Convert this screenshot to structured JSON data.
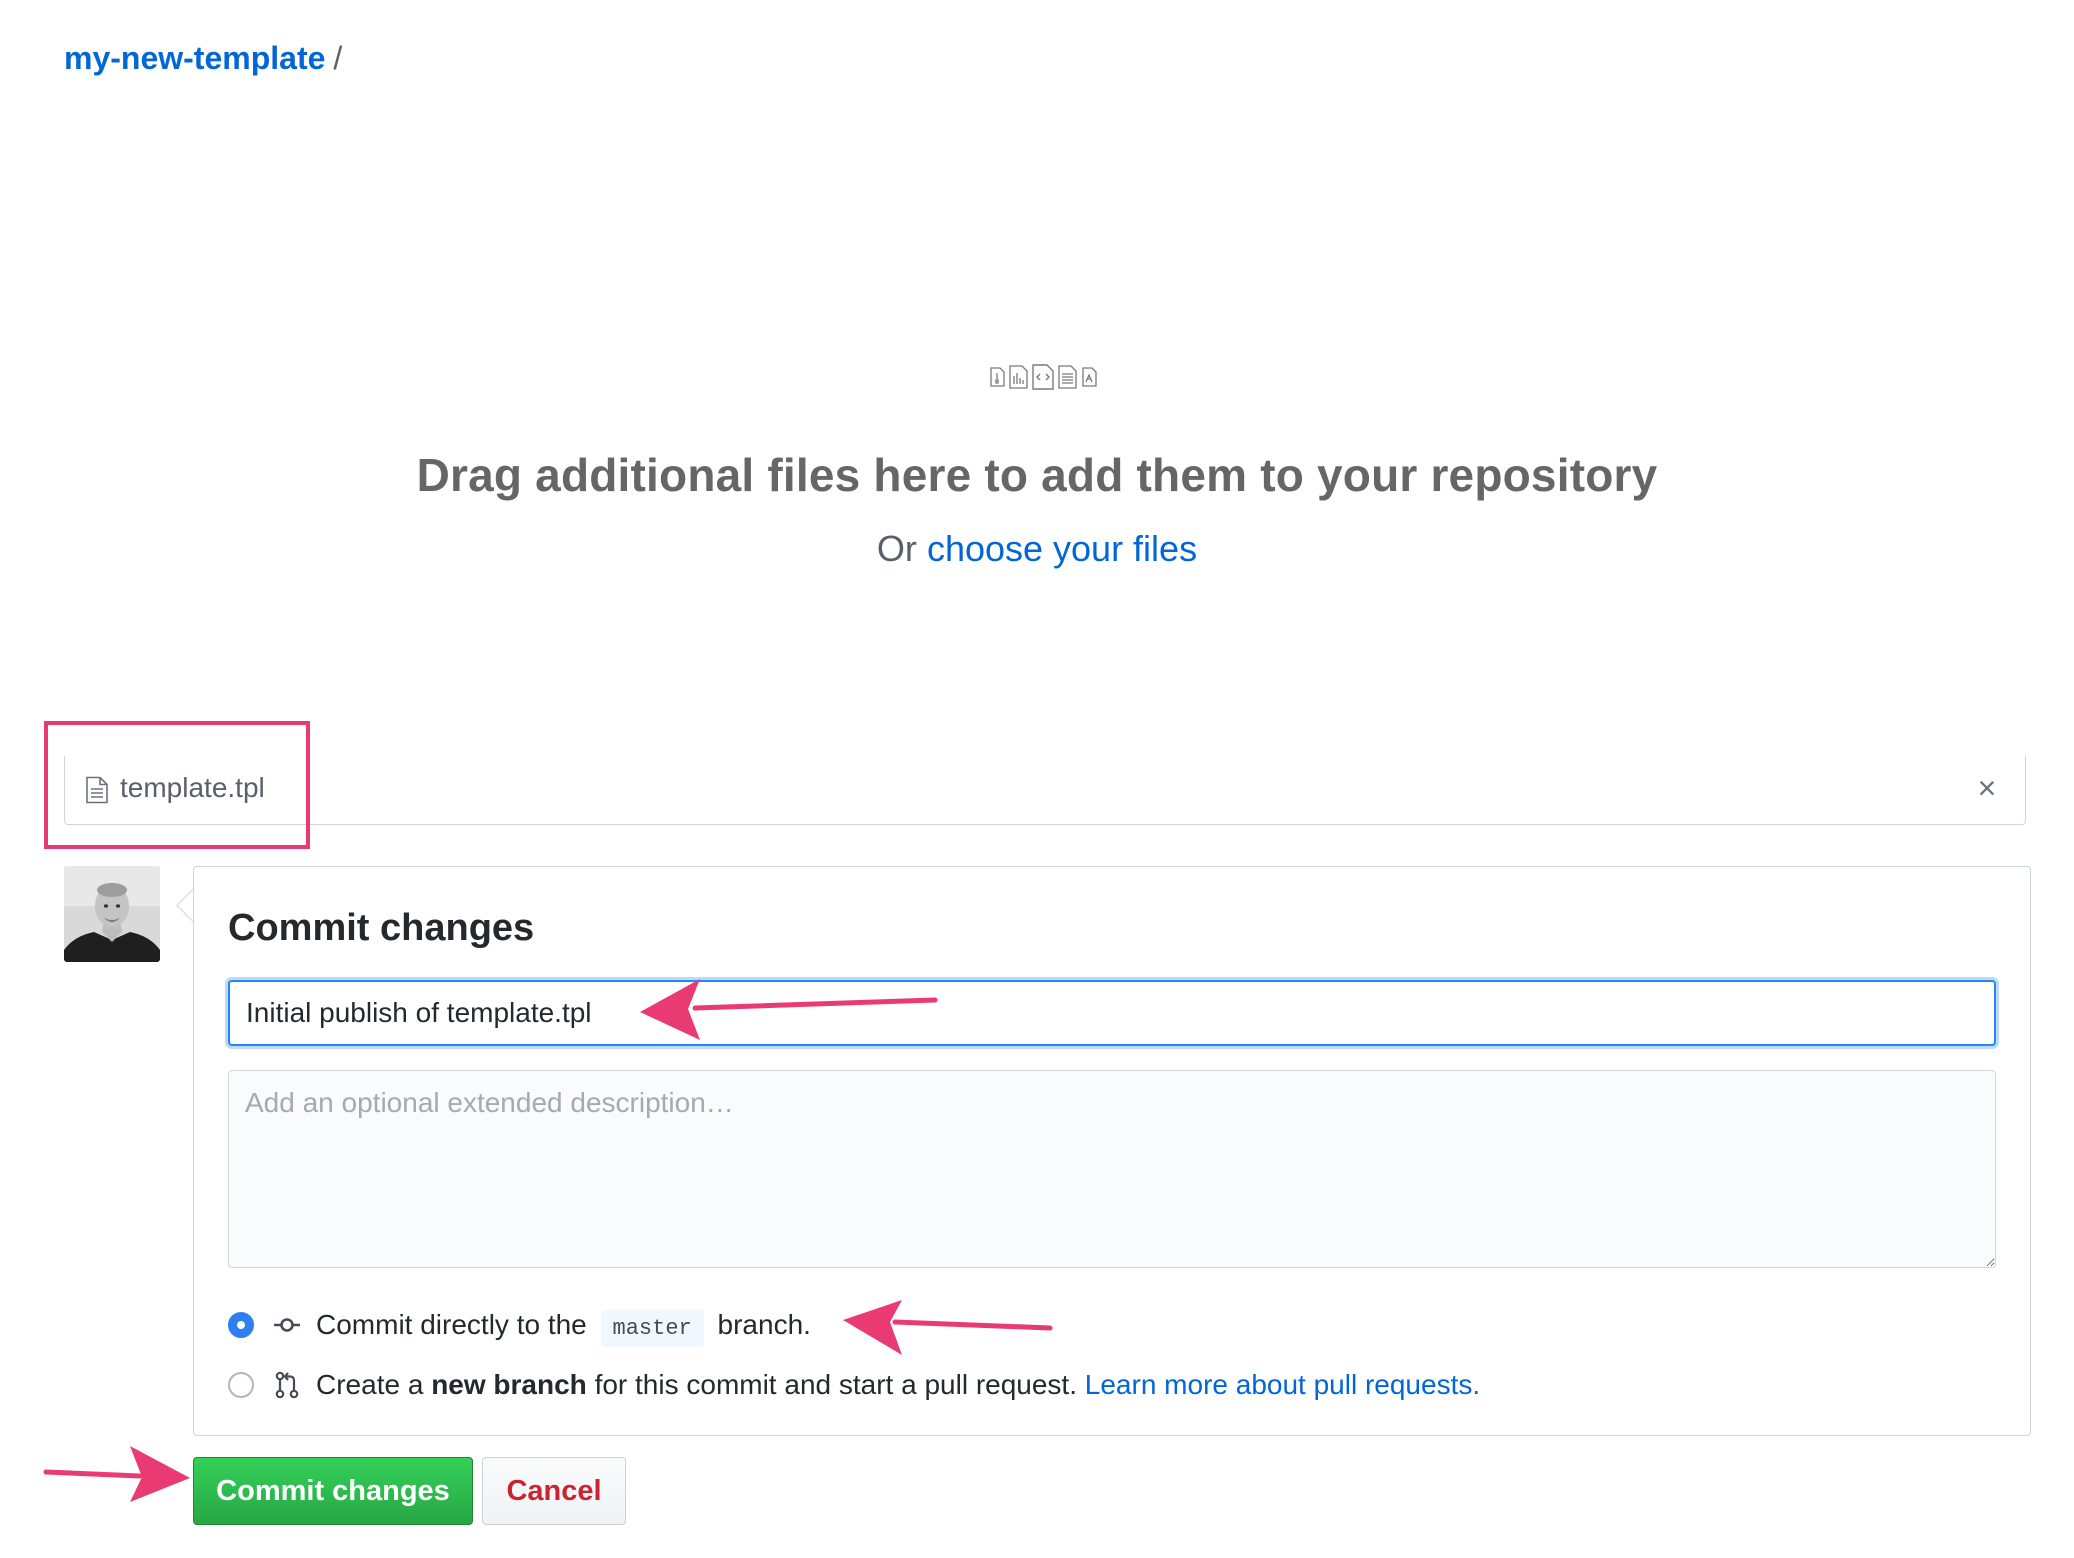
{
  "breadcrumb": {
    "repo": "my-new-template",
    "separator": "/"
  },
  "dropzone": {
    "title": "Drag additional files here to add them to your repository",
    "prefix": "Or",
    "link": "choose your files"
  },
  "file": {
    "name": "template.tpl",
    "remove_icon": "×"
  },
  "commit": {
    "heading": "Commit changes",
    "summary_value": "Initial publish of template.tpl",
    "description_placeholder": "Add an optional extended description…",
    "option_direct": {
      "before": "Commit directly to the",
      "branch": "master",
      "after": "branch.",
      "checked": true
    },
    "option_new_branch": {
      "prefix": "Create a",
      "bold": "new branch",
      "suffix": "for this commit and start a pull request.",
      "link": "Learn more about pull requests.",
      "checked": false
    }
  },
  "buttons": {
    "commit": "Commit changes",
    "cancel": "Cancel"
  },
  "colors": {
    "link": "#0366d6",
    "primary_button": "#28a745",
    "danger_text": "#cb2431",
    "annotation": "#ea3a72",
    "focus_border": "#2188ff"
  },
  "icons": {
    "file_types": [
      "file-zip-icon",
      "file-chart-icon",
      "file-code-icon",
      "file-text-icon",
      "file-pdf-icon"
    ],
    "uploaded_file": "file-text-icon",
    "remove": "close-icon",
    "commit": "git-commit-icon",
    "pull_request": "git-pull-request-icon"
  }
}
